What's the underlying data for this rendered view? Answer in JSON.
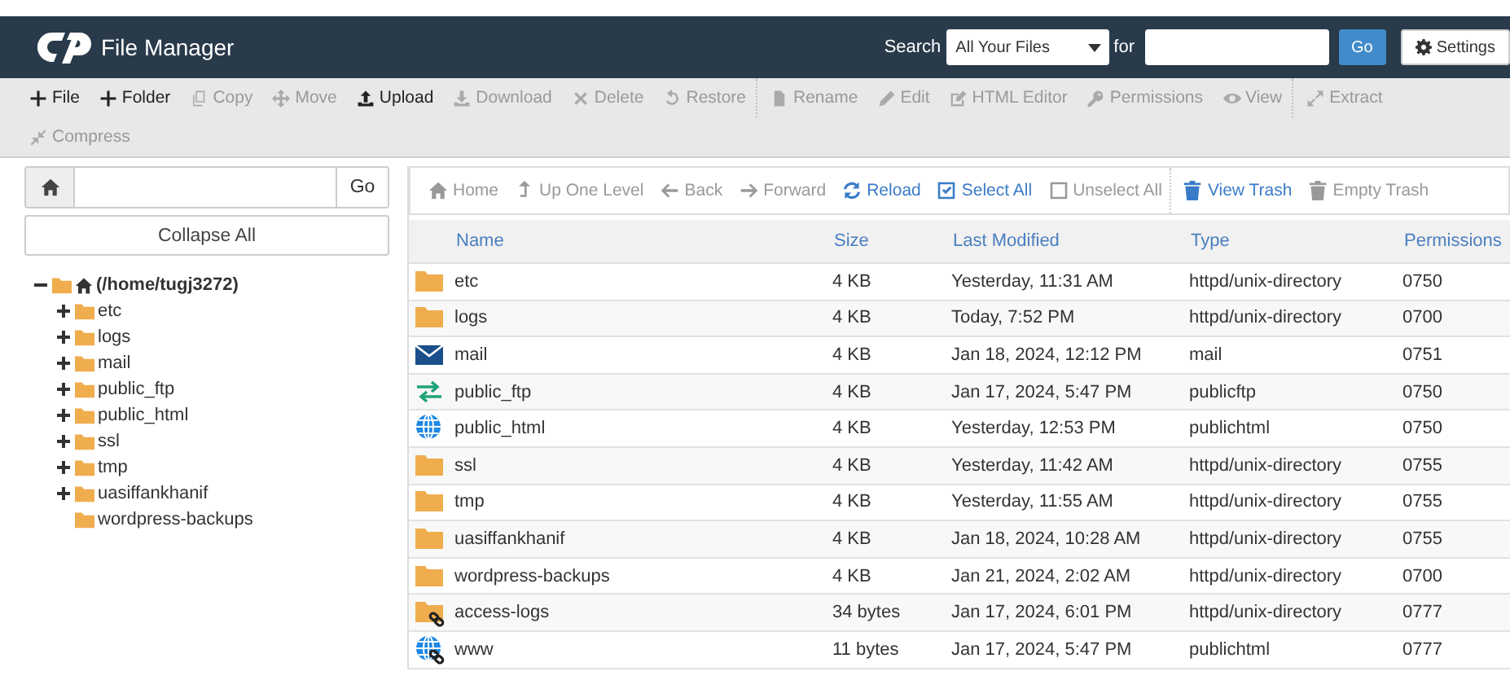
{
  "header": {
    "title": "File Manager",
    "search_label": "Search",
    "scope": "All Your Files",
    "for_label": "for",
    "go": "Go",
    "settings": "Settings"
  },
  "toolbar": [
    {
      "kind": "plus",
      "label": "File",
      "disabled": false,
      "divider": false
    },
    {
      "kind": "plus",
      "label": "Folder",
      "disabled": false,
      "divider": false
    },
    {
      "kind": "copy",
      "label": "Copy",
      "disabled": true,
      "divider": false
    },
    {
      "kind": "move",
      "label": "Move",
      "disabled": true,
      "divider": false
    },
    {
      "kind": "upload",
      "label": "Upload",
      "disabled": false,
      "divider": false
    },
    {
      "kind": "download",
      "label": "Download",
      "disabled": true,
      "divider": false
    },
    {
      "kind": "close",
      "label": "Delete",
      "disabled": true,
      "divider": false
    },
    {
      "kind": "undo",
      "label": "Restore",
      "disabled": true,
      "divider": false
    },
    {
      "kind": "file",
      "label": "Rename",
      "disabled": true,
      "divider": true
    },
    {
      "kind": "pencil",
      "label": "Edit",
      "disabled": true,
      "divider": false
    },
    {
      "kind": "edit",
      "label": "HTML Editor",
      "disabled": true,
      "divider": false
    },
    {
      "kind": "key",
      "label": "Permissions",
      "disabled": true,
      "divider": false
    },
    {
      "kind": "eye",
      "label": "View",
      "disabled": true,
      "divider": false
    },
    {
      "kind": "expand",
      "label": "Extract",
      "disabled": true,
      "divider": true
    },
    {
      "kind": "compress",
      "label": "Compress",
      "disabled": true,
      "divider": false
    }
  ],
  "path_bar": {
    "go": "Go"
  },
  "collapse_all": "Collapse All",
  "tree": {
    "label": "(/home/tugj3272)",
    "expanded": true,
    "children": [
      {
        "label": "etc",
        "expandable": true
      },
      {
        "label": "logs",
        "expandable": true
      },
      {
        "label": "mail",
        "expandable": true
      },
      {
        "label": "public_ftp",
        "expandable": true
      },
      {
        "label": "public_html",
        "expandable": true
      },
      {
        "label": "ssl",
        "expandable": true
      },
      {
        "label": "tmp",
        "expandable": true
      },
      {
        "label": "uasiffankhanif",
        "expandable": true
      },
      {
        "label": "wordpress-backups",
        "expandable": false
      }
    ]
  },
  "nav": [
    {
      "kind": "home",
      "label": "Home",
      "disabled": true,
      "divider": false
    },
    {
      "kind": "up",
      "label": "Up One Level",
      "disabled": true,
      "divider": false
    },
    {
      "kind": "back",
      "label": "Back",
      "disabled": true,
      "divider": false
    },
    {
      "kind": "forward",
      "label": "Forward",
      "disabled": true,
      "divider": false
    },
    {
      "kind": "reload",
      "label": "Reload",
      "disabled": false,
      "divider": false
    },
    {
      "kind": "checkbox",
      "label": "Select All",
      "disabled": false,
      "divider": false
    },
    {
      "kind": "square",
      "label": "Unselect All",
      "disabled": true,
      "divider": false
    },
    {
      "kind": "trash",
      "label": "View Trash",
      "disabled": false,
      "divider": true
    },
    {
      "kind": "trash",
      "label": "Empty Trash",
      "disabled": true,
      "divider": false
    }
  ],
  "table": {
    "columns": [
      "Name",
      "Size",
      "Last Modified",
      "Type",
      "Permissions"
    ],
    "rows": [
      {
        "kind": "folder",
        "name": "etc",
        "size": "4 KB",
        "modified": "Yesterday, 11:31 AM",
        "type": "httpd/unix-directory",
        "permissions": "0750"
      },
      {
        "kind": "folder",
        "name": "logs",
        "size": "4 KB",
        "modified": "Today, 7:52 PM",
        "type": "httpd/unix-directory",
        "permissions": "0700"
      },
      {
        "kind": "mail",
        "name": "mail",
        "size": "4 KB",
        "modified": "Jan 18, 2024, 12:12 PM",
        "type": "mail",
        "permissions": "0751"
      },
      {
        "kind": "ftp",
        "name": "public_ftp",
        "size": "4 KB",
        "modified": "Jan 17, 2024, 5:47 PM",
        "type": "publicftp",
        "permissions": "0750"
      },
      {
        "kind": "web",
        "name": "public_html",
        "size": "4 KB",
        "modified": "Yesterday, 12:53 PM",
        "type": "publichtml",
        "permissions": "0750"
      },
      {
        "kind": "folder",
        "name": "ssl",
        "size": "4 KB",
        "modified": "Yesterday, 11:42 AM",
        "type": "httpd/unix-directory",
        "permissions": "0755"
      },
      {
        "kind": "folder",
        "name": "tmp",
        "size": "4 KB",
        "modified": "Yesterday, 11:55 AM",
        "type": "httpd/unix-directory",
        "permissions": "0755"
      },
      {
        "kind": "folder",
        "name": "uasiffankhanif",
        "size": "4 KB",
        "modified": "Jan 18, 2024, 10:28 AM",
        "type": "httpd/unix-directory",
        "permissions": "0755"
      },
      {
        "kind": "folder",
        "name": "wordpress-backups",
        "size": "4 KB",
        "modified": "Jan 21, 2024, 2:02 AM",
        "type": "httpd/unix-directory",
        "permissions": "0700"
      },
      {
        "kind": "folder-link",
        "name": "access-logs",
        "size": "34 bytes",
        "modified": "Jan 17, 2024, 6:01 PM",
        "type": "httpd/unix-directory",
        "permissions": "0777"
      },
      {
        "kind": "web-link",
        "name": "www",
        "size": "11 bytes",
        "modified": "Jan 17, 2024, 5:47 PM",
        "type": "publichtml",
        "permissions": "0777"
      }
    ]
  }
}
